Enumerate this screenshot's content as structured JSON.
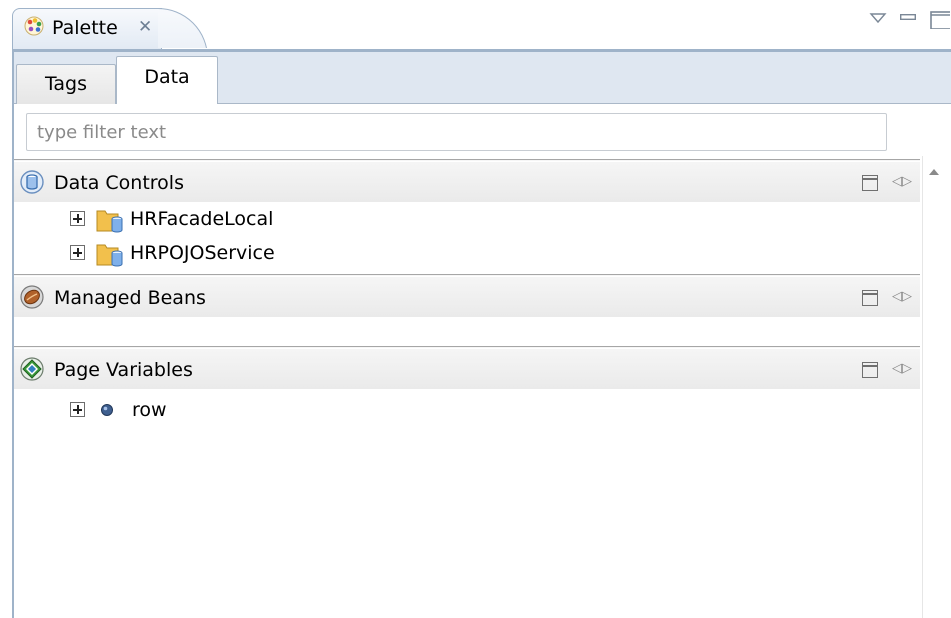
{
  "view": {
    "title": "Palette",
    "icons": [
      "palette-icon",
      "close-icon",
      "view-menu-icon",
      "minimize-icon",
      "maximize-icon"
    ]
  },
  "tabs": [
    {
      "label": "Tags",
      "selected": false
    },
    {
      "label": "Data",
      "selected": true
    }
  ],
  "filter": {
    "value": "",
    "placeholder": "type filter text"
  },
  "sections": [
    {
      "title": "Data Controls",
      "icon": "data-controls-icon",
      "items": [
        {
          "label": "HRFacadeLocal",
          "icon": "folder-datacontrol-icon"
        },
        {
          "label": "HRPOJOService",
          "icon": "folder-datacontrol-icon"
        }
      ]
    },
    {
      "title": "Managed Beans",
      "icon": "managed-beans-icon",
      "items": []
    },
    {
      "title": "Page Variables",
      "icon": "page-variables-icon",
      "items": [
        {
          "label": "row",
          "icon": "variable-dot-icon"
        }
      ]
    }
  ],
  "colors": {
    "tab_border": "#9fb3c9",
    "tabs_bar_bg": "#dfe7f1",
    "section_header_bg": "#eaeaea"
  }
}
